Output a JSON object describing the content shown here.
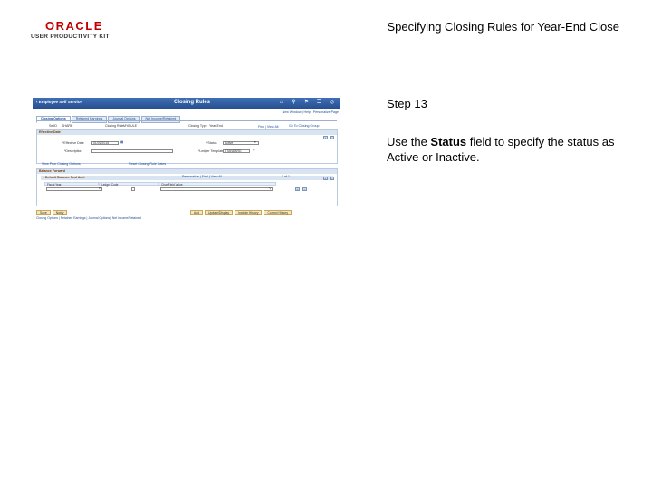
{
  "slide": {
    "logo_line1": "ORACLE",
    "logo_line2": "USER PRODUCTIVITY KIT",
    "title": "Specifying Closing Rules for Year-End Close",
    "step": "Step 13",
    "instruction_pre": "Use the ",
    "instruction_bold": "Status",
    "instruction_post": " field to specify the status as Active or Inactive."
  },
  "app": {
    "home_link": "Employee Self Service",
    "page_title": "Closing Rules",
    "header_icons": [
      "home-icon",
      "search-icon",
      "flag-icon",
      "menu-icon",
      "navbar-icon"
    ],
    "nav_links": "New Window | Help | Personalize Page",
    "tabs": [
      "Closing Options",
      "Retained Earnings",
      "Journal Options",
      "Net Income/Retained"
    ],
    "summary": {
      "setid_label": "SetID",
      "setid_value": "SHARE",
      "rule_label": "Closing Rule",
      "rule_value": "MYRULE",
      "type_label": "Closing Type",
      "type_value": "Year-End",
      "find_link": "Find | View All",
      "nav_link": "Go To Closing Group"
    },
    "effective": {
      "header": "Effective Date",
      "date_label": "*Effective Date",
      "date_value": "01/01/2015",
      "status_label": "*Status",
      "status_value": "Active",
      "desc_label": "*Description",
      "desc_value": "",
      "template_label": "*Ledger Template",
      "template_value": "STANDARD"
    },
    "links": {
      "left": "View Prior Closing Options",
      "mid": "Reset Closing Rule Dates"
    },
    "balance": {
      "header": "Balance Forward",
      "sub_header": "Default Balance Fwd Acct",
      "col1": "Fiscal Year",
      "col2": "Ledger Code",
      "col3": "ChartField Value",
      "pager": "Personalize | Find | View All",
      "range": "1 of 1"
    },
    "buttons": [
      "Save",
      "Notify",
      "Add",
      "Update/Display",
      "Include History",
      "Correct History"
    ],
    "footer_links": "Closing Options | Retained Earnings | Journal Options | Net Income/Retained"
  }
}
